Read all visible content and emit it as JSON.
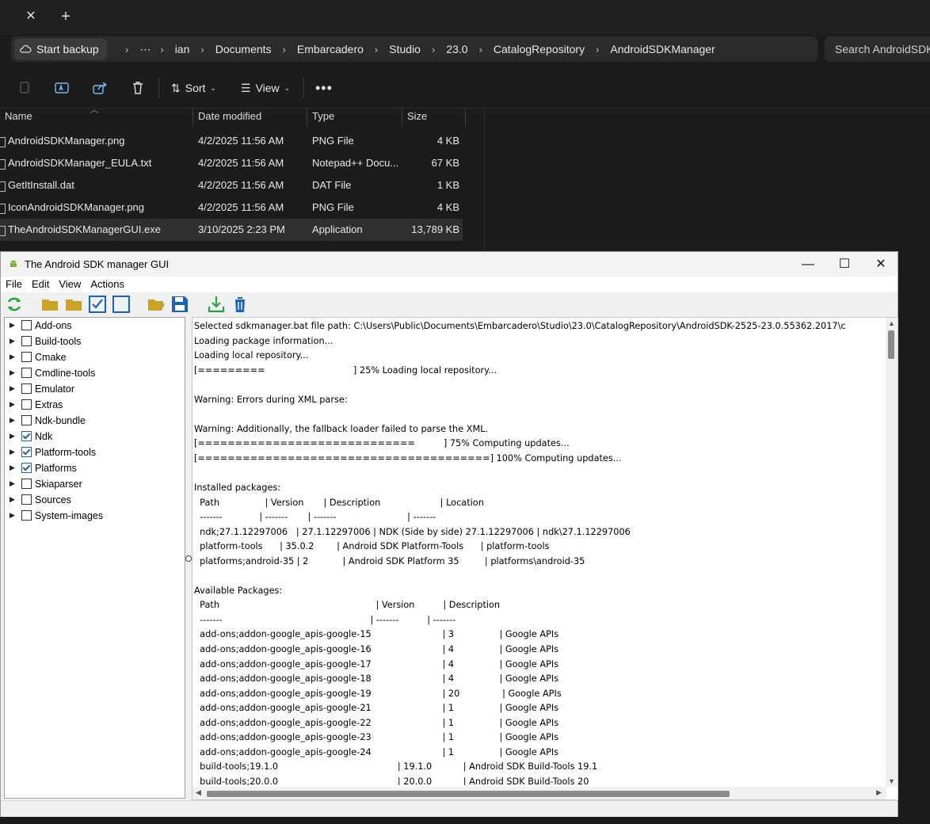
{
  "explorer": {
    "backup_label": "Start backup",
    "breadcrumb": [
      "ian",
      "Documents",
      "Embarcadero",
      "Studio",
      "23.0",
      "CatalogRepository",
      "AndroidSDKManager"
    ],
    "search_placeholder": "Search AndroidSDKManager",
    "sort_label": "Sort",
    "view_label": "View",
    "columns": [
      "Name",
      "Date modified",
      "Type",
      "Size"
    ],
    "files": [
      {
        "name": "AndroidSDKManager.png",
        "date": "4/2/2025 11:56 AM",
        "type": "PNG File",
        "size": "4 KB"
      },
      {
        "name": "AndroidSDKManager_EULA.txt",
        "date": "4/2/2025 11:56 AM",
        "type": "Notepad++ Docu...",
        "size": "67 KB"
      },
      {
        "name": "GetItInstall.dat",
        "date": "4/2/2025 11:56 AM",
        "type": "DAT File",
        "size": "1 KB"
      },
      {
        "name": "IconAndroidSDKManager.png",
        "date": "4/2/2025 11:56 AM",
        "type": "PNG File",
        "size": "4 KB"
      },
      {
        "name": "TheAndroidSDKManagerGUI.exe",
        "date": "3/10/2025 2:23 PM",
        "type": "Application",
        "size": "13,789 KB"
      }
    ]
  },
  "sdk": {
    "title": "The Android SDK manager GUI",
    "menu": [
      "File",
      "Edit",
      "View",
      "Actions"
    ],
    "tree": [
      {
        "label": "Add-ons",
        "checked": false
      },
      {
        "label": "Build-tools",
        "checked": false
      },
      {
        "label": "Cmake",
        "checked": false
      },
      {
        "label": "Cmdline-tools",
        "checked": false
      },
      {
        "label": "Emulator",
        "checked": false
      },
      {
        "label": "Extras",
        "checked": false
      },
      {
        "label": "Ndk-bundle",
        "checked": false
      },
      {
        "label": "Ndk",
        "checked": true
      },
      {
        "label": "Platform-tools",
        "checked": true
      },
      {
        "label": "Platforms",
        "checked": true
      },
      {
        "label": "Skiaparser",
        "checked": false
      },
      {
        "label": "Sources",
        "checked": false
      },
      {
        "label": "System-images",
        "checked": false
      }
    ],
    "log_lines": [
      "Selected sdkmanager.bat file path: C:\\Users\\Public\\Documents\\Embarcadero\\Studio\\23.0\\CatalogRepository\\AndroidSDK-2525-23.0.55362.2017\\c",
      "Loading package information...",
      "Loading local repository...",
      "[=========                               ] 25% Loading local repository...",
      "",
      "Warning: Errors during XML parse:",
      "",
      "Warning: Additionally, the fallback loader failed to parse the XML.",
      "[=============================          ] 75% Computing updates...",
      "[=======================================] 100% Computing updates...",
      "",
      "Installed packages:",
      "  Path                | Version       | Description                     | Location",
      "  -------             | -------       | -------                         | -------",
      "  ndk;27.1.12297006   | 27.1.12297006 | NDK (Side by side) 27.1.12297006 | ndk\\27.1.12297006",
      "  platform-tools      | 35.0.2        | Android SDK Platform-Tools      | platform-tools",
      "  platforms;android-35 | 2            | Android SDK Platform 35         | platforms\\android-35",
      "",
      "Available Packages:",
      "  Path                                                       | Version          | Description",
      "  -------                                                    | -------          | -------",
      "  add-ons;addon-google_apis-google-15                         | 3                | Google APIs",
      "  add-ons;addon-google_apis-google-16                         | 4                | Google APIs",
      "  add-ons;addon-google_apis-google-17                         | 4                | Google APIs",
      "  add-ons;addon-google_apis-google-18                         | 4                | Google APIs",
      "  add-ons;addon-google_apis-google-19                         | 20               | Google APIs",
      "  add-ons;addon-google_apis-google-21                         | 1                | Google APIs",
      "  add-ons;addon-google_apis-google-22                         | 1                | Google APIs",
      "  add-ons;addon-google_apis-google-23                         | 1                | Google APIs",
      "  add-ons;addon-google_apis-google-24                         | 1                | Google APIs",
      "  build-tools;19.1.0                                          | 19.1.0           | Android SDK Build-Tools 19.1",
      "  build-tools;20.0.0                                          | 20.0.0           | Android SDK Build-Tools 20"
    ]
  },
  "icons": {
    "refresh": "refresh-icon",
    "folder": "folder-icon",
    "check_all": "check-all-icon",
    "uncheck_all": "uncheck-all-icon",
    "open": "open-folder-icon",
    "save": "save-icon",
    "install": "download-icon",
    "delete": "trash-icon"
  },
  "colors": {
    "explorer_bg": "#1c1c1c",
    "accent": "#1764c0",
    "folder": "#c9a227",
    "install": "#2ea043"
  }
}
